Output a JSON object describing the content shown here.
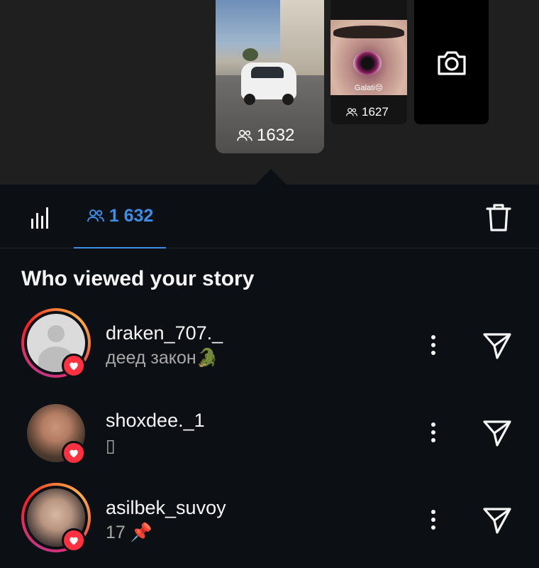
{
  "stories": {
    "main": {
      "viewer_count": "1632"
    },
    "secondary": {
      "viewer_count": "1627",
      "caption": "Galati😔"
    },
    "camera": {
      "icon": "camera-icon"
    }
  },
  "tabs": {
    "insights_icon": "bar-chart-icon",
    "viewers_count": "1 632",
    "delete_icon": "trash-icon"
  },
  "section_title": "Who viewed your story",
  "viewers": [
    {
      "username": "draken_707._",
      "subtext": "деед закон🐊",
      "avatar": "default",
      "ring": true,
      "liked": true
    },
    {
      "username": "shoxdee._1",
      "subtext": "▯",
      "avatar": "photo",
      "ring": false,
      "liked": true
    },
    {
      "username": "asilbek_suvoy",
      "subtext": "17 📌",
      "avatar": "photo",
      "ring": true,
      "liked": true
    }
  ],
  "colors": {
    "background": "#0c1014",
    "accent": "#3a8ee6",
    "heart": "#ff3040",
    "muted_text": "#a8a8a8"
  }
}
